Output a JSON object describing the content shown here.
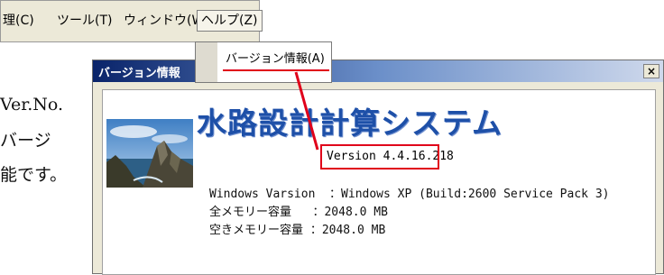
{
  "menubar": {
    "items": [
      "理(C)",
      "ツール(T)",
      "ウィンドウ(W)",
      "ヘルプ(Z)"
    ]
  },
  "background_text": [
    "Ver.No.",
    "バージ",
    "能です。"
  ],
  "dropdown": {
    "item": "バージョン情報(A)"
  },
  "dialog": {
    "title": "バージョン情報",
    "close_glyph": "×",
    "app_title": "水路設計計算システム",
    "version": "Version 4.4.16.218",
    "info": [
      "Windows Varsion  ：Windows XP (Build:2600 Service Pack 3)",
      "全メモリー容量   ：2048.0 MB",
      "空きメモリー容量 ：2048.0 MB"
    ]
  },
  "colors": {
    "highlight": "#e0001a",
    "title_blue": "#1e50a8",
    "titlebar": "#0a246a"
  }
}
